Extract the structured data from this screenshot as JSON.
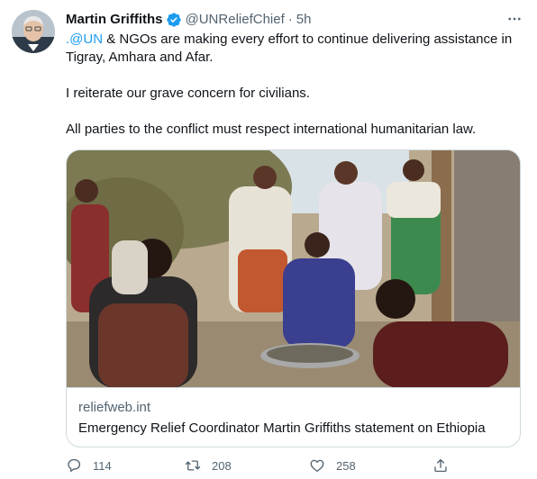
{
  "tweet": {
    "author_name": "Martin Griffiths",
    "handle": "@UNReliefChief",
    "separator": "·",
    "time": "5h",
    "text_mention": ".@UN",
    "text_line1_rest": " & NGOs are making every effort to continue delivering assistance in Tigray, Amhara and Afar.",
    "text_line2": "I reiterate our grave concern for civilians.",
    "text_line3": "All parties to the conflict must respect international humanitarian law."
  },
  "card": {
    "domain": "reliefweb.int",
    "title": "Emergency Relief Coordinator Martin Griffiths statement on Ethiopia"
  },
  "actions": {
    "reply_count": "114",
    "retweet_count": "208",
    "like_count": "258"
  },
  "icons": {
    "verified": "verified-badge-icon",
    "more": "more-horizontal-icon",
    "reply": "reply-icon",
    "retweet": "retweet-icon",
    "like": "heart-icon",
    "share": "share-icon"
  },
  "colors": {
    "accent": "#1d9bf0",
    "secondary_text": "#536471",
    "border": "#cfd9de"
  }
}
